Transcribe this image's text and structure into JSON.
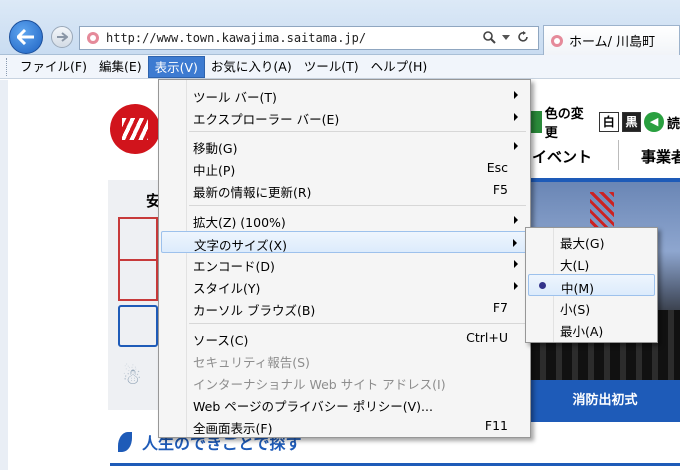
{
  "browser": {
    "url": "http://www.town.kawajima.saitama.jp/",
    "tab_title": "ホーム/ 川島町",
    "search_icon": "magnifier-icon",
    "refresh_icon": "refresh-icon"
  },
  "menubar": {
    "items": [
      "ファイル(F)",
      "編集(E)",
      "表示(V)",
      "お気に入り(A)",
      "ツール(T)",
      "ヘルプ(H)"
    ]
  },
  "view_menu": {
    "items": [
      {
        "label": "ツール バー(T)",
        "submenu": true
      },
      {
        "label": "エクスプローラー バー(E)",
        "submenu": true
      },
      {
        "label": "移動(G)",
        "submenu": true
      },
      {
        "label": "中止(P)",
        "shortcut": "Esc"
      },
      {
        "label": "最新の情報に更新(R)",
        "shortcut": "F5"
      },
      {
        "label": "拡大(Z) (100%)",
        "submenu": true
      },
      {
        "label": "文字のサイズ(X)",
        "submenu": true,
        "highlighted": true
      },
      {
        "label": "エンコード(D)",
        "submenu": true
      },
      {
        "label": "スタイル(Y)",
        "submenu": true
      },
      {
        "label": "カーソル ブラウズ(B)",
        "shortcut": "F7"
      },
      {
        "label": "ソース(C)",
        "shortcut": "Ctrl+U"
      },
      {
        "label": "セキュリティ報告(S)",
        "disabled": true
      },
      {
        "label": "インターナショナル Web サイト アドレス(I)",
        "disabled": true
      },
      {
        "label": "Web ページのプライバシー ポリシー(V)..."
      },
      {
        "label": "全画面表示(F)",
        "shortcut": "F11"
      }
    ]
  },
  "text_size_submenu": {
    "items": [
      {
        "label": "最大(G)"
      },
      {
        "label": "大(L)"
      },
      {
        "label": "中(M)",
        "selected": true
      },
      {
        "label": "小(S)"
      },
      {
        "label": "最小(A)"
      }
    ]
  },
  "page": {
    "color_change_label": "色の変更",
    "white_button": "白",
    "black_button": "黒",
    "reading_partial": "読",
    "nav_event": "イベント",
    "nav_business": "事業者",
    "left_partial": "安",
    "banner_text": "消防出初式",
    "section_heading": "人生のできごとで探す",
    "accent_color": "#1e5bb8"
  }
}
